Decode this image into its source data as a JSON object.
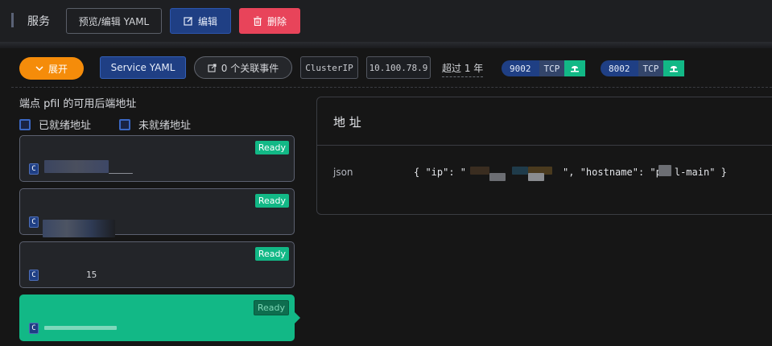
{
  "toolbar": {
    "title": "服务",
    "preview_yaml": "预览/编辑 YAML",
    "edit": "编辑",
    "delete": "删除"
  },
  "info": {
    "expand": "展开",
    "service_yaml": "Service YAML",
    "events": "0 个关联事件",
    "type": "ClusterIP",
    "cluster_ip": "10.100.78.9",
    "age": "超过 1 年",
    "ports": [
      {
        "port": "9002",
        "protocol": "TCP",
        "icon": "network-icon"
      },
      {
        "port": "8002",
        "protocol": "TCP",
        "icon": "network-icon"
      }
    ]
  },
  "endpoints": {
    "title": "端点 pfil 的可用后端地址",
    "legend_ready": "已就绪地址",
    "legend_not_ready": "未就绪地址",
    "items": [
      {
        "kind": "C",
        "status": "Ready",
        "ip": ""
      },
      {
        "kind": "C",
        "status": "Ready",
        "ip": ""
      },
      {
        "kind": "C",
        "status": "Ready",
        "ip": "15"
      },
      {
        "kind": "C",
        "status": "Ready",
        "ip": ""
      }
    ]
  },
  "detail": {
    "title": "地 址",
    "label": "json",
    "json_prefix": "{ \"ip\": \"",
    "json_mid": "\", \"hostname\": \"p",
    "json_suffix": "l-main\" }"
  },
  "colors": {
    "accent_orange": "#f58c0a",
    "primary_blue": "#1f3f84",
    "danger": "#e8445a",
    "ready_green": "#12b886"
  }
}
